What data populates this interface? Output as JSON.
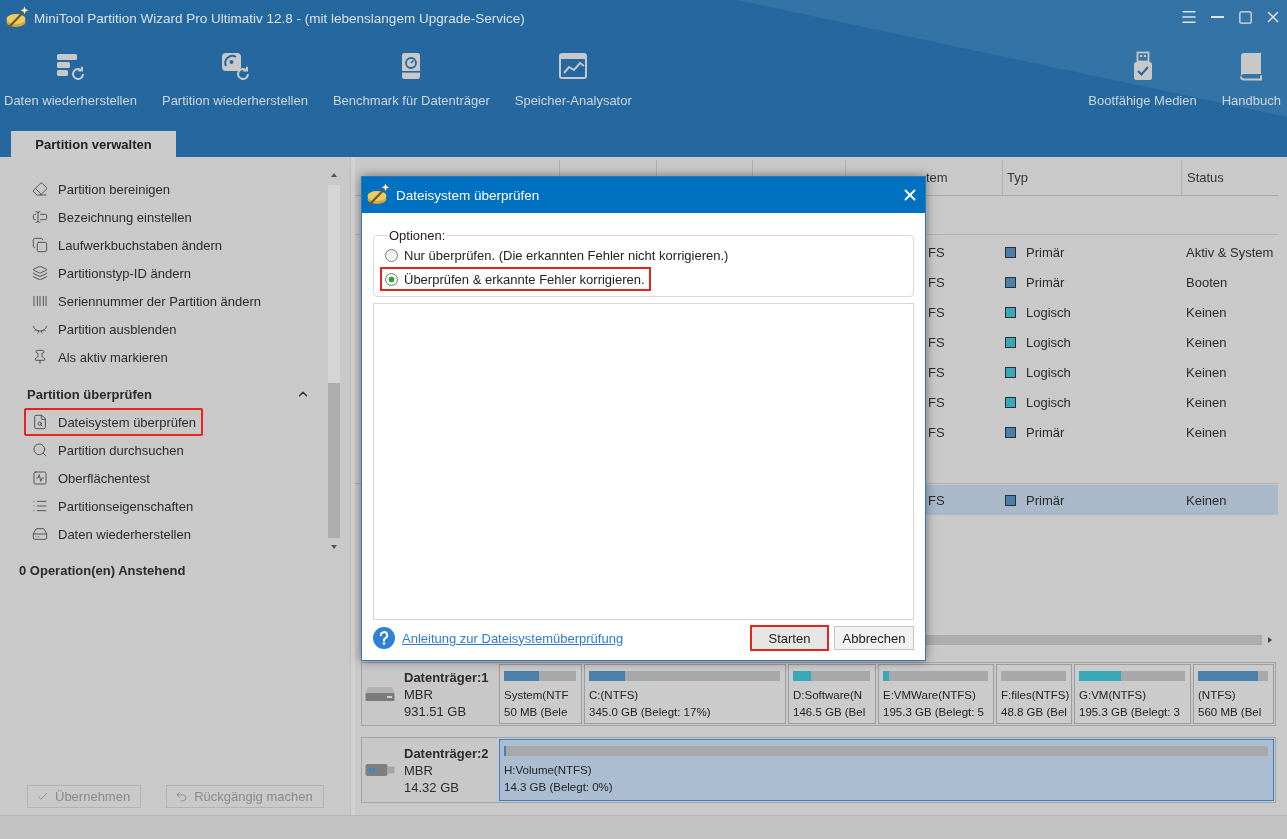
{
  "window": {
    "title": "MiniTool Partition Wizard Pro Ultimativ 12.8 - (mit lebenslangem Upgrade-Service)"
  },
  "toolbar": {
    "left": [
      {
        "label": "Daten wiederherstellen"
      },
      {
        "label": "Partition wiederherstellen"
      },
      {
        "label": "Benchmark für Datenträger"
      },
      {
        "label": "Speicher-Analysator"
      }
    ],
    "right": [
      {
        "label": "Bootfähige Medien"
      },
      {
        "label": "Handbuch"
      }
    ]
  },
  "tabs": [
    {
      "label": "Partition verwalten",
      "selected": true
    }
  ],
  "sidebar": {
    "groups": [
      {
        "items": [
          {
            "label": "Partition bereinigen",
            "highlighted": false
          },
          {
            "label": "Bezeichnung einstellen",
            "highlighted": false
          },
          {
            "label": "Laufwerkbuchstaben ändern",
            "highlighted": false
          },
          {
            "label": "Partitionstyp-ID ändern",
            "highlighted": false
          },
          {
            "label": "Seriennummer der Partition ändern",
            "highlighted": false
          },
          {
            "label": "Partition ausblenden",
            "highlighted": false
          },
          {
            "label": "Als aktiv markieren",
            "highlighted": false
          }
        ]
      },
      {
        "title": "Partition überprüfen",
        "expanded": true,
        "items": [
          {
            "label": "Dateisystem überprüfen",
            "highlighted": true
          },
          {
            "label": "Partition durchsuchen",
            "highlighted": false
          },
          {
            "label": "Oberflächentest",
            "highlighted": false
          },
          {
            "label": "Partitionseigenschaften",
            "highlighted": false
          },
          {
            "label": "Daten wiederherstellen",
            "highlighted": false
          }
        ]
      }
    ],
    "pending": "0 Operation(en) Anstehend",
    "buttons": [
      {
        "label": "Übernehmen",
        "disabled": true
      },
      {
        "label": "Rückgängig machen",
        "disabled": true
      }
    ]
  },
  "partition_table": {
    "columns": [
      "tem",
      "Typ",
      "Status"
    ],
    "disks": [
      {
        "partitions": [
          {
            "file_system": "FS",
            "type": "Primär",
            "color": "#4a7fa8",
            "status": "Aktiv & System",
            "selected": false
          },
          {
            "file_system": "FS",
            "type": "Primär",
            "color": "#4a7fa8",
            "status": "Booten",
            "selected": false
          },
          {
            "file_system": "FS",
            "type": "Logisch",
            "color": "#3aa8b8",
            "status": "Keinen",
            "selected": false
          },
          {
            "file_system": "FS",
            "type": "Logisch",
            "color": "#3aa8b8",
            "status": "Keinen",
            "selected": false
          },
          {
            "file_system": "FS",
            "type": "Logisch",
            "color": "#3aa8b8",
            "status": "Keinen",
            "selected": false
          },
          {
            "file_system": "FS",
            "type": "Logisch",
            "color": "#3aa8b8",
            "status": "Keinen",
            "selected": false
          },
          {
            "file_system": "FS",
            "type": "Primär",
            "color": "#4a7fa8",
            "status": "Keinen",
            "selected": false
          }
        ]
      },
      {
        "partitions": [
          {
            "file_system": "FS",
            "type": "Primär",
            "color": "#4a7fa8",
            "status": "Keinen",
            "selected": true
          }
        ]
      }
    ]
  },
  "disk_map": [
    {
      "name": "Datenträger:1",
      "scheme": "MBR",
      "size": "931.51 GB",
      "kind": "hdd",
      "partitions": [
        {
          "label": "System(NTF",
          "detail": "50 MB (Bele",
          "level": 0.48,
          "color": "#4a80aa",
          "selected": false
        },
        {
          "label": "C:(NTFS)",
          "detail": "345.0 GB (Belegt: 17%)",
          "level": 0.19,
          "color": "#4a80aa",
          "selected": false
        },
        {
          "label": "D:Software(N",
          "detail": "146.5 GB (Bel",
          "level": 0.23,
          "color": "#38a9b9",
          "selected": false
        },
        {
          "label": "E:VMWare(NTFS)",
          "detail": "195.3 GB (Belegt: 5",
          "level": 0.06,
          "color": "#38a9b9",
          "selected": false
        },
        {
          "label": "F:files(NTFS)",
          "detail": "48.8 GB (Bel",
          "selected": false
        },
        {
          "label": "G:VM(NTFS)",
          "detail": "195.3 GB (Belegt: 3",
          "level": 0.4,
          "color": "#38a9b9",
          "selected": false
        },
        {
          "label": "(NTFS)",
          "detail": "560 MB (Bel",
          "level": 0.86,
          "color": "#4a80aa",
          "selected": false
        }
      ]
    },
    {
      "name": "Datenträger:2",
      "scheme": "MBR",
      "size": "14.32 GB",
      "kind": "usb",
      "partitions": [
        {
          "label": "H:Volume(NTFS)",
          "detail": "14.3 GB (Belegt: 0%)",
          "level": 0.003,
          "color": "#4a80aa",
          "selected": true
        }
      ]
    }
  ],
  "dialog": {
    "title": "Dateisystem überprüfen",
    "group_label": "Optionen:",
    "options": [
      {
        "label": "Nur überprüfen. (Die erkannten Fehler nicht korrigieren.)",
        "selected": false,
        "highlighted": false
      },
      {
        "label": "Überprüfen & erkannte Fehler korrigieren.",
        "selected": true,
        "highlighted": true
      }
    ],
    "help_link": "Anleitung zur Dateisystemüberprüfung",
    "buttons": [
      {
        "label": "Starten",
        "highlighted": true
      },
      {
        "label": "Abbrechen",
        "highlighted": false
      }
    ]
  }
}
